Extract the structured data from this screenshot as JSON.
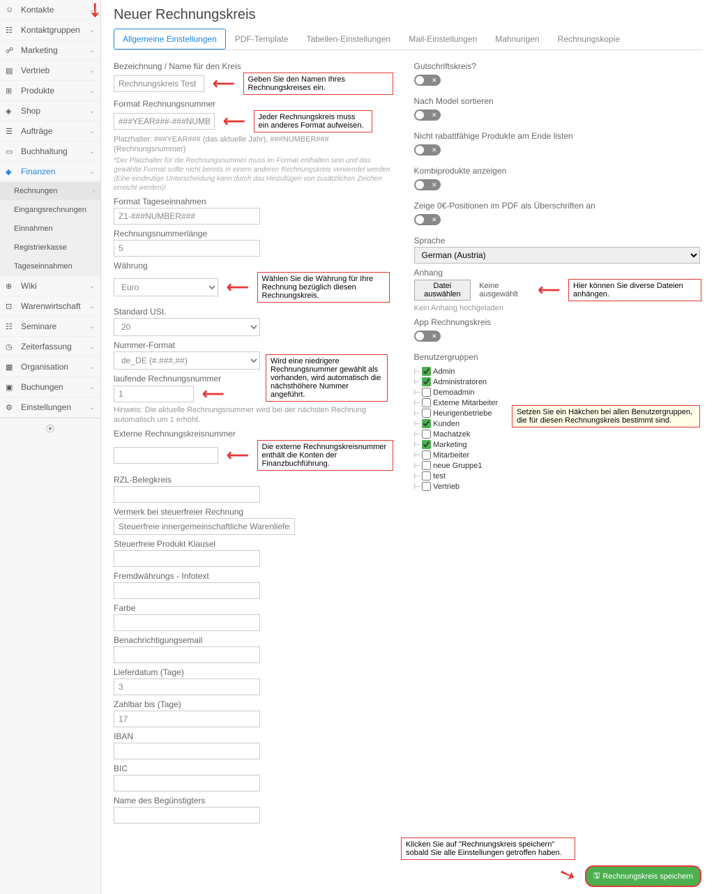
{
  "sidebar": {
    "items": [
      {
        "label": "Kontakte"
      },
      {
        "label": "Kontaktgruppen"
      },
      {
        "label": "Marketing"
      },
      {
        "label": "Vertrieb"
      },
      {
        "label": "Produkte"
      },
      {
        "label": "Shop"
      },
      {
        "label": "Aufträge"
      },
      {
        "label": "Buchhaltung"
      },
      {
        "label": "Finanzen",
        "active": true
      },
      {
        "label": "Wiki"
      },
      {
        "label": "Warenwirtschaft"
      },
      {
        "label": "Seminare"
      },
      {
        "label": "Zeiterfassung"
      },
      {
        "label": "Organisation"
      },
      {
        "label": "Buchungen"
      },
      {
        "label": "Einstellungen"
      }
    ],
    "sub": [
      {
        "label": "Rechnungen",
        "active": true
      },
      {
        "label": "Eingangsrechnungen"
      },
      {
        "label": "Einnahmen"
      },
      {
        "label": "Registrierkasse"
      },
      {
        "label": "Tageseinnahmen"
      }
    ]
  },
  "page": {
    "title": "Neuer Rechnungskreis"
  },
  "tabs": [
    {
      "label": "Allgemeine Einstellungen",
      "active": true
    },
    {
      "label": "PDF-Template"
    },
    {
      "label": "Tabellen-Einstellungen"
    },
    {
      "label": "Mail-Einstellungen"
    },
    {
      "label": "Mahnungen"
    },
    {
      "label": "Rechnungskopie"
    }
  ],
  "left": {
    "name_label": "Bezeichnung / Name für den Kreis",
    "name_value": "Rechnungskreis Test",
    "name_callout": "Geben Sie den Namen Ihres Rechnungskreises ein.",
    "format_label": "Format Rechnungsnummer",
    "format_value": "###YEAR###-###NUMBER###",
    "format_callout": "Jeder Rechnungskreis muss ein anderes Format aufweisen.",
    "platzhalter": "Platzhalter: ###YEAR### (das aktuelle Jahr), ###NUMBER### (Rechnungsnummer)",
    "platzhalter_hint": "*Der Platzhalter für die Rechnungsnummer muss im Format enthalten sein und das gewählte Format sollte nicht bereits in einem anderen Rechnungskreis verwendet werden (Eine eindeutige Unterscheidung kann durch das Hinzufügen von zusätzlichen Zeichen erreicht werden)!",
    "tages_label": "Format Tageseinnahmen",
    "tages_value": "Z1-###NUMBER###",
    "numlen_label": "Rechnungsnummerlänge",
    "numlen_value": "5",
    "currency_label": "Währung",
    "currency_value": "Euro",
    "currency_callout": "Wählen Sie die Währung für Ihre Rechnung bezüglich diesen Rechnungskreis.",
    "ust_label": "Standard USt.",
    "ust_value": "20",
    "numfmt_label": "Nummer-Format",
    "numfmt_value": "de_DE (#.###,##)",
    "running_label": "laufende Rechnungsnummer",
    "running_value": "1",
    "running_callout": "Wird eine niedrigere Rechnungsnummer gewählt als vorhanden, wird automatisch die nächsthöhere Nummer angeführt.",
    "running_hint": "Hinweis: Die aktuelle Rechnungsnummer wird bei der nächsten Rechnung automatisch um 1 erhöht.",
    "extern_label": "Externe Rechnungskreisnummer",
    "extern_callout": "Die externe Rechnungskreisnummer enthält die Konten der Finanzbuchführung.",
    "rzl_label": "RZL-Belegkreis",
    "vermerk_label": "Vermerk bei steuerfreier Rechnung",
    "vermerk_placeholder": "Steuerfreie innergemeinschaftliche Warenliefer",
    "klausel_label": "Steuerfreie Produkt Klausel",
    "fremd_label": "Fremdwährungs - Infotext",
    "farbe_label": "Farbe",
    "email_label": "Benachrichtigungsemail",
    "liefer_label": "Lieferdatum (Tage)",
    "liefer_value": "3",
    "zahlbar_label": "Zahlbar bis (Tage)",
    "zahlbar_value": "17",
    "iban_label": "IBAN",
    "bic_label": "BIC",
    "begunst_label": "Name des Begünstigters"
  },
  "right": {
    "gutschrift_label": "Gutschriftskreis?",
    "model_label": "Nach Model sortieren",
    "rabatt_label": "Nicht rabattfähige Produkte am Ende listen",
    "kombi_label": "Kombiprodukte anzeigen",
    "zeropos_label": "Zeige 0€-Positionen im PDF als Überschriften an",
    "sprache_label": "Sprache",
    "sprache_value": "German (Austria)",
    "anhang_label": "Anhang",
    "file_button": "Datei auswählen",
    "file_status": "Keine ausgewählt",
    "file_hint": "Kein Anhang hochgeladen",
    "anhang_callout": "Hier können Sie diverse Dateien anhängen.",
    "app_label": "App Rechnungskreis",
    "groups_label": "Benutzergruppen",
    "groups": [
      {
        "name": "Admin",
        "checked": true
      },
      {
        "name": "Administratoren",
        "checked": true
      },
      {
        "name": "Demoadmin",
        "checked": false
      },
      {
        "name": "Externe Mitarbeiter",
        "checked": false
      },
      {
        "name": "Heurigenbetriebe",
        "checked": false
      },
      {
        "name": "Kunden",
        "checked": true
      },
      {
        "name": "Machatzek",
        "checked": false
      },
      {
        "name": "Marketing",
        "checked": true
      },
      {
        "name": "Mitarbeiter",
        "checked": false
      },
      {
        "name": "neue Gruppe1",
        "checked": false
      },
      {
        "name": "test",
        "checked": false
      },
      {
        "name": "Vertrieb",
        "checked": false
      }
    ],
    "groups_callout": "Setzen Sie ein Häkchen bei allen Benutzergruppen, die für diesen Rechnungskreis bestimmt sind."
  },
  "bottom": {
    "save_callout": "Klicken Sie auf \"Rechnungskreis speichern\" sobald Sie alle Einstellungen getroffen haben.",
    "save_button": "Rechnungskreis speichern"
  }
}
